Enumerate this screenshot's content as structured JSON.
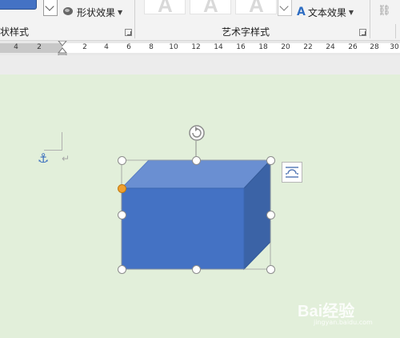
{
  "ribbon": {
    "shape_effects_label": "形状效果",
    "shape_styles_group": "状样式",
    "wordart_letter": "A",
    "wordart_group": "艺术字样式",
    "text_effects_label": "文本效果"
  },
  "ruler": {
    "ticks": [
      "4",
      "2",
      "2",
      "4",
      "6",
      "8",
      "10",
      "12",
      "14",
      "16",
      "18",
      "20",
      "22",
      "24",
      "26",
      "28",
      "30"
    ]
  },
  "colors": {
    "shape_fill": "#4472c4",
    "canvas_background": "#e2efda",
    "handle_accent": "#f0a030"
  },
  "icons": [
    "anchor-icon",
    "paragraph-mark-icon",
    "rotate-icon",
    "layout-options-icon",
    "shape-effects-icon",
    "text-effects-icon",
    "link-icon"
  ],
  "watermark": {
    "text": "Bai经验",
    "sub": "jingyan.baidu.com"
  }
}
